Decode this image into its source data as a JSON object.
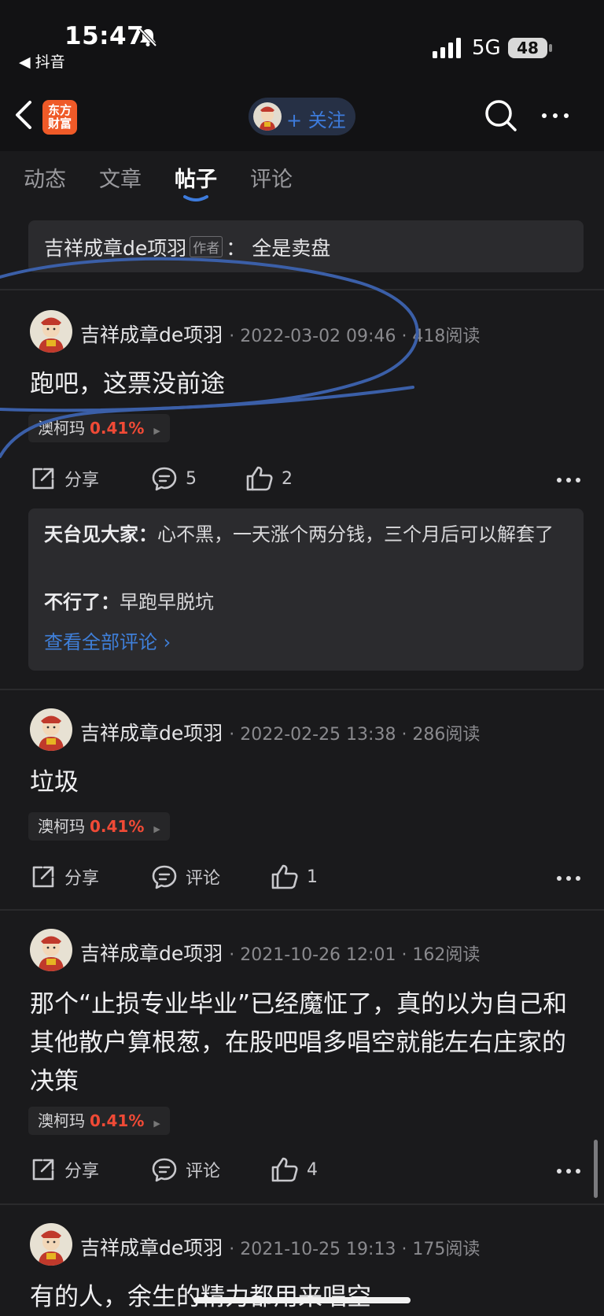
{
  "status_bar": {
    "time": "15:47",
    "back_app": "◀ 抖音",
    "network": "5G",
    "battery": "48"
  },
  "header": {
    "logo_line1": "东方",
    "logo_line2": "财富",
    "follow_label": "+ 关注",
    "icons": [
      "back-icon",
      "search-icon",
      "more-icon"
    ]
  },
  "tabs": [
    {
      "label": "动态",
      "active": false
    },
    {
      "label": "文章",
      "active": false
    },
    {
      "label": "帖子",
      "active": true
    },
    {
      "label": "评论",
      "active": false
    }
  ],
  "author_reply": {
    "name": "吉祥成章de项羽",
    "tag": "作者",
    "text": "： 全是卖盘"
  },
  "posts": [
    {
      "author": "吉祥成章de项羽",
      "time": "· 2022-03-02 09:46 · 418阅读",
      "content": "跑吧，这票没前途",
      "stock_name": "澳柯玛",
      "stock_pct": "0.41%",
      "share": "分享",
      "comment": "5",
      "like": "2",
      "comments": [
        {
          "name": "天台见大家：",
          "text": "心不黑，一天涨个两分钱，三个月后可以解套了"
        },
        {
          "name": "不行了：",
          "text": "早跑早脱坑"
        }
      ],
      "see_all": "查看全部评论 ›"
    },
    {
      "author": "吉祥成章de项羽",
      "time": "· 2022-02-25 13:38 · 286阅读",
      "content": "垃圾",
      "stock_name": "澳柯玛",
      "stock_pct": "0.41%",
      "share": "分享",
      "comment": "评论",
      "like": "1"
    },
    {
      "author": "吉祥成章de项羽",
      "time": "· 2021-10-26 12:01 · 162阅读",
      "content": "那个“止损专业毕业”已经魔怔了，真的以为自己和其他散户算根葱，在股吧唱多唱空就能左右庄家的决策",
      "stock_name": "澳柯玛",
      "stock_pct": "0.41%",
      "share": "分享",
      "comment": "评论",
      "like": "4"
    },
    {
      "author": "吉祥成章de项羽",
      "time": "· 2021-10-25 19:13 · 175阅读",
      "content": "有的人，余生的精力都用来唱空"
    }
  ],
  "colors": {
    "background": "#1a1a1c",
    "accent_blue": "#3d7bdc",
    "stock_red": "#f04a36",
    "logo_orange": "#ef5a28",
    "annotation_blue": "#3b5fa8"
  }
}
